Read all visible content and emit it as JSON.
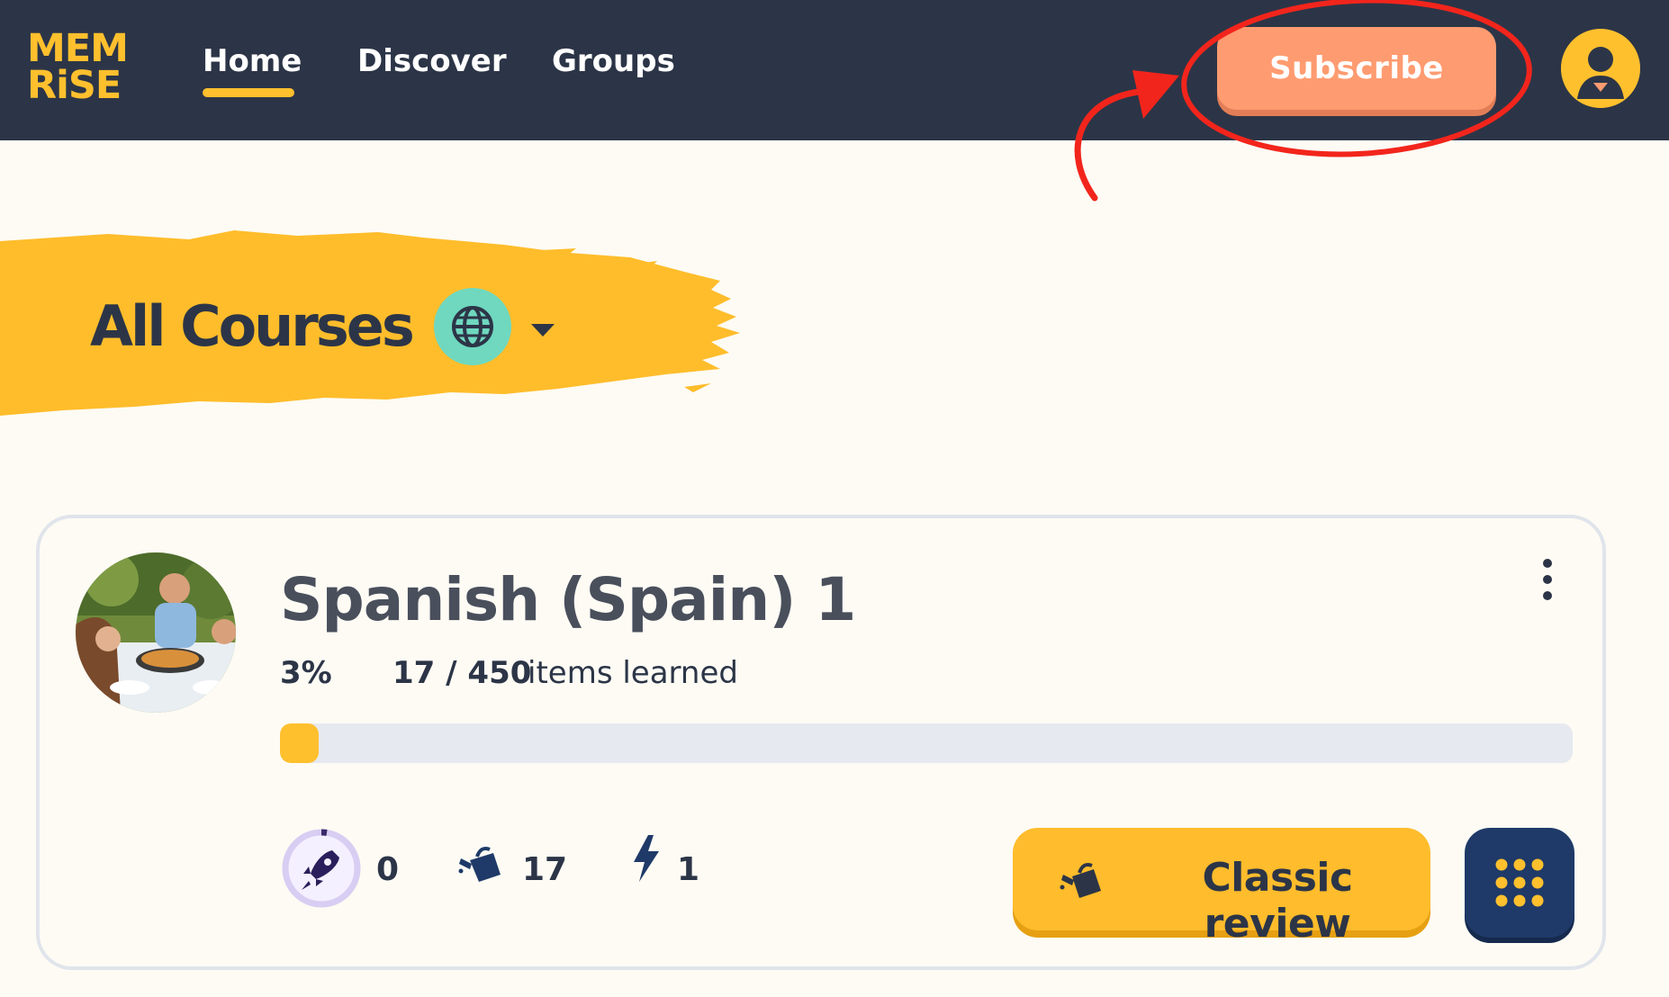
{
  "brand": {
    "logo_line1": "MEM",
    "logo_line2": "RiSE"
  },
  "nav": {
    "items": [
      {
        "label": "Home",
        "active": true
      },
      {
        "label": "Discover",
        "active": false
      },
      {
        "label": "Groups",
        "active": false
      }
    ]
  },
  "header": {
    "subscribe_label": "Subscribe",
    "avatar_icon": "user-avatar-icon"
  },
  "page": {
    "title": "All Courses",
    "language_filter_icon": "globe-icon"
  },
  "course": {
    "title": "Spanish (Spain) 1",
    "progress_percent_label": "3%",
    "progress_fraction": 0.03,
    "learned_count": "17 / 450",
    "learned_label": "items learned",
    "stats": [
      {
        "icon": "rocket-icon",
        "value": "0"
      },
      {
        "icon": "watering-can-icon",
        "value": "17"
      },
      {
        "icon": "lightning-icon",
        "value": "1"
      }
    ],
    "review_label": "Classic review",
    "review_icon": "watering-can-icon",
    "modes_icon": "grid-dots-icon"
  },
  "colors": {
    "header_bg": "#2c3547",
    "accent_yellow": "#ffc02e",
    "subscribe_bg": "#ff9b70",
    "annotation_red": "#f2251c",
    "globe_bg": "#6fd8bf",
    "modes_bg": "#1f3a68"
  }
}
